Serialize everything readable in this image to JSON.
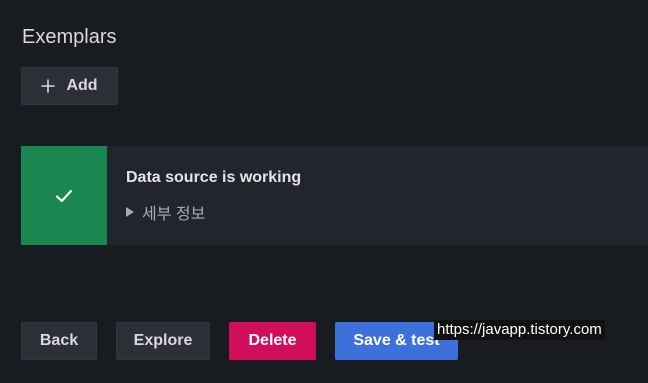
{
  "exemplars": {
    "title": "Exemplars",
    "add_label": "Add",
    "add_icon": "plus-icon"
  },
  "alert": {
    "status": "success",
    "icon": "check-icon",
    "color": "#1b8750",
    "title": "Data source is working",
    "details_label": "세부 정보"
  },
  "footer": {
    "back_label": "Back",
    "explore_label": "Explore",
    "delete_label": "Delete",
    "save_label": "Save & test",
    "delete_color": "#d10e5c",
    "save_color": "#3d71d9"
  },
  "watermark": {
    "text": "https://javapp.tistory.com"
  }
}
